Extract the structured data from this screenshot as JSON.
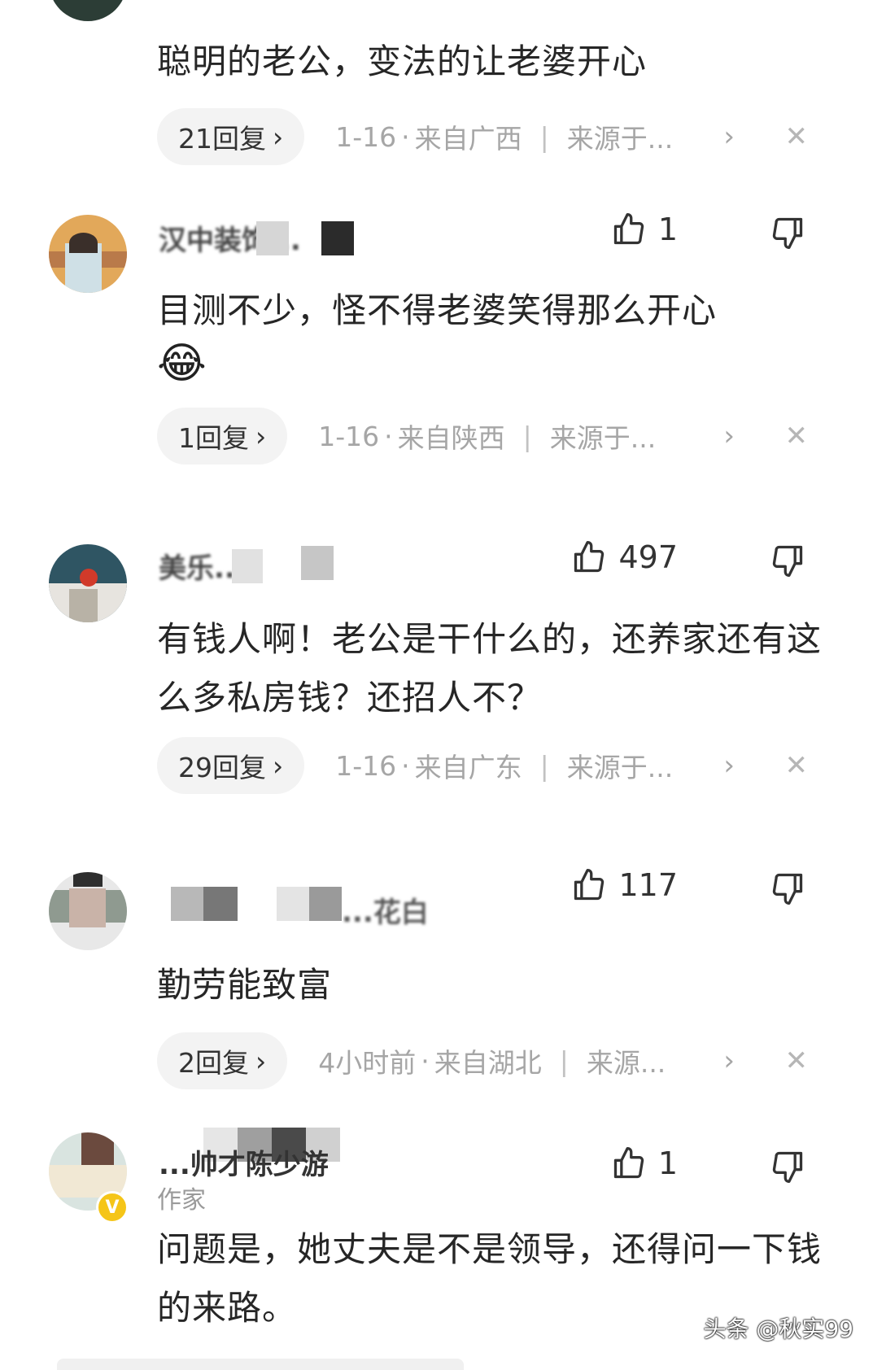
{
  "comments": [
    {
      "body": "聪明的老公，变法的让老婆开心",
      "replies": "21回复",
      "date": "1-16",
      "location": "来自广西",
      "source": "来源于..."
    },
    {
      "name": "汉中装饰...",
      "likes": "1",
      "body": "目测不少，怪不得老婆笑得那么开心",
      "emoji": "😂",
      "replies": "1回复",
      "date": "1-16",
      "location": "来自陕西",
      "source": "来源于..."
    },
    {
      "name": "美乐...",
      "likes": "497",
      "body": "有钱人啊！老公是干什么的，还养家还有这么多私房钱？还招人不？",
      "replies": "29回复",
      "date": "1-16",
      "location": "来自广东",
      "source": "来源于..."
    },
    {
      "name": "...花白",
      "likes": "117",
      "body": "勤劳能致富",
      "replies": "2回复",
      "date": "4小时前",
      "location": "来自湖北",
      "source": "来源..."
    },
    {
      "name": "...帅才陈少游",
      "role": "作家",
      "likes": "1",
      "body": "问题是，她丈夫是不是领导，还得问一下钱的来路。"
    }
  ],
  "icons": {
    "reply_chevron": "›",
    "row_chevron": "›",
    "close": "✕",
    "dot": "·",
    "divider": "|",
    "verified_badge": "V"
  },
  "watermark": "头条 @秋实99",
  "colors": {
    "meta": "#a6a6a6",
    "pill": "#f3f3f3",
    "badge": "#f5c518"
  }
}
